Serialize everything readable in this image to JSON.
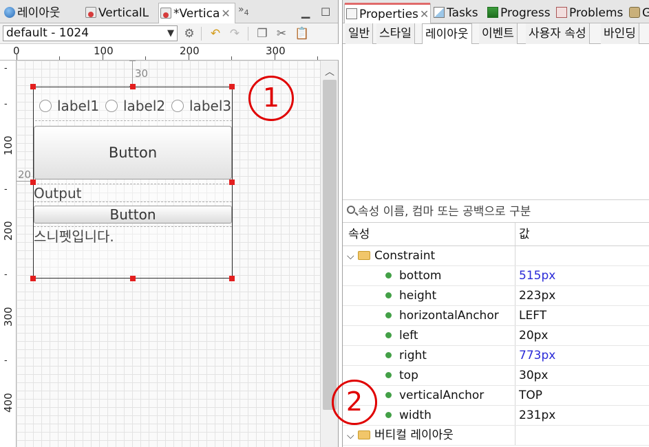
{
  "editor": {
    "tabs": [
      {
        "label": "레이아웃",
        "icon": "globe-icon"
      },
      {
        "label": "VerticalL",
        "icon": "java-file-icon"
      },
      {
        "label": "*Vertica",
        "icon": "java-file-icon"
      }
    ],
    "overflow_label": "»",
    "overflow_count": "4",
    "resolution": "default - 1024",
    "ruler_h": [
      "0",
      "100",
      "200",
      "300"
    ],
    "ruler_v": [
      "100",
      "200",
      "300",
      "400"
    ],
    "dim_top": "30",
    "dim_left": "20",
    "widgets": {
      "radios": [
        "label1",
        "label2",
        "label3"
      ],
      "button_big": "Button",
      "output": "Output",
      "button_small": "Button",
      "snippet": "스니펫입니다."
    },
    "callout": "1"
  },
  "properties": {
    "view_tabs": [
      {
        "label": "Properties",
        "icon": "properties-icon"
      },
      {
        "label": "Tasks",
        "icon": "tasks-icon"
      },
      {
        "label": "Progress",
        "icon": "progress-icon"
      },
      {
        "label": "Problems",
        "icon": "problems-icon"
      },
      {
        "label": "G",
        "icon": "git-icon"
      }
    ],
    "sub_tabs": [
      "일반",
      "스타일",
      "레이아웃",
      "이벤트",
      "사용자 속성",
      "바인딩"
    ],
    "active_sub_tab": "레이아웃",
    "filter_placeholder": "속성 이름, 컴마 또는 공백으로 구분",
    "columns": {
      "name": "속성",
      "value": "값"
    },
    "groups": [
      {
        "name": "Constraint",
        "expanded": true,
        "rows": [
          {
            "name": "bottom",
            "value": "515px",
            "modified": true
          },
          {
            "name": "height",
            "value": "223px",
            "modified": false
          },
          {
            "name": "horizontalAnchor",
            "value": "LEFT",
            "modified": false
          },
          {
            "name": "left",
            "value": "20px",
            "modified": false
          },
          {
            "name": "right",
            "value": "773px",
            "modified": true
          },
          {
            "name": "top",
            "value": "30px",
            "modified": false
          },
          {
            "name": "verticalAnchor",
            "value": "TOP",
            "modified": false
          },
          {
            "name": "width",
            "value": "231px",
            "modified": false
          }
        ]
      },
      {
        "name": "버티컬 레이아웃",
        "expanded": true,
        "rows": []
      }
    ],
    "callout": "2",
    "modified_color": "#2a2ad8",
    "selection_color": "#e31e1e"
  }
}
